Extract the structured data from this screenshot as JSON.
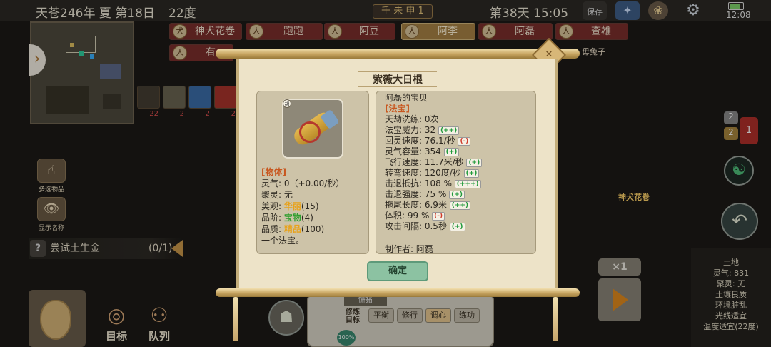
{
  "topbar": {
    "date": "天苍246年 夏 第18日",
    "temperature": "22度",
    "ganzhi": "壬 未 申 1",
    "day_time": "第38天 15:05",
    "save_label": "保存",
    "clock": "12:08"
  },
  "characters": {
    "row1": [
      "神犬花卷",
      "跑跑",
      "阿豆",
      "阿李",
      "阿磊",
      "查雄"
    ],
    "row2_visible": [
      "有",
      "毋兔子"
    ],
    "selected": "阿李"
  },
  "inventory_counts": [
    "22",
    "2",
    "2",
    "2"
  ],
  "left_tools": {
    "multi_select": "多选物品",
    "show_names": "显示名称"
  },
  "quest": {
    "text": "尝试土生金",
    "progress": "(0/1)"
  },
  "right_side": {
    "pet_label": "神犬花卷",
    "badge_top": "2",
    "badge_mid": "2",
    "badge_red": "1"
  },
  "status_panel": {
    "lines": [
      "土地",
      "灵气: 831",
      "聚灵: 无",
      "土壤良质",
      "环境脏乱",
      "光线适宜",
      "温度适宜(22度)"
    ]
  },
  "speed": "×1",
  "bottom": {
    "goal_label": "目标",
    "queue_label": "队列",
    "cultivate": {
      "state": "懈猪",
      "heading": "修炼目标",
      "tabs": [
        "平衡",
        "修行",
        "调心",
        "练功"
      ],
      "selected": "调心",
      "percent": "100%"
    }
  },
  "modal": {
    "title": "紫薇大日根",
    "tag": "葫",
    "left": {
      "category": "[物体]",
      "lingqi_label": "灵气: ",
      "lingqi_value": "0（+0.00/秒）",
      "juling": "聚灵: 无",
      "beauty_label": "美观: ",
      "beauty_value": "华丽",
      "beauty_num": "(15)",
      "grade_label": "品阶: ",
      "grade_value": "宝物",
      "grade_num": "(4)",
      "quality_label": "品质: ",
      "quality_value": "精品",
      "quality_num": "(100)",
      "desc": "一个法宝。"
    },
    "right": {
      "owner": "阿磊的宝贝",
      "category": "[法宝]",
      "stats": [
        {
          "text": "天劫洗练: 0次",
          "mark": ""
        },
        {
          "text": "法宝威力: 32 ",
          "mark": "(++)"
        },
        {
          "text": "回灵速度: 76.1/秒 ",
          "mark": "(-)"
        },
        {
          "text": "灵气容量: 354 ",
          "mark": "(+)"
        },
        {
          "text": "飞行速度: 11.7米/秒 ",
          "mark": "(+)"
        },
        {
          "text": "转弯速度: 120度/秒 ",
          "mark": "(+)"
        },
        {
          "text": "击退抵抗: 108 % ",
          "mark": "(+++)"
        },
        {
          "text": "击退强度: 75 % ",
          "mark": "(+)"
        },
        {
          "text": "拖尾长度: 6.9米 ",
          "mark": "(++)"
        },
        {
          "text": "体积: 99 % ",
          "mark": "(-)"
        },
        {
          "text": "攻击间隔: 0.5秒 ",
          "mark": "(+)"
        }
      ],
      "maker": "制作者: 阿磊"
    },
    "confirm": "确定"
  }
}
